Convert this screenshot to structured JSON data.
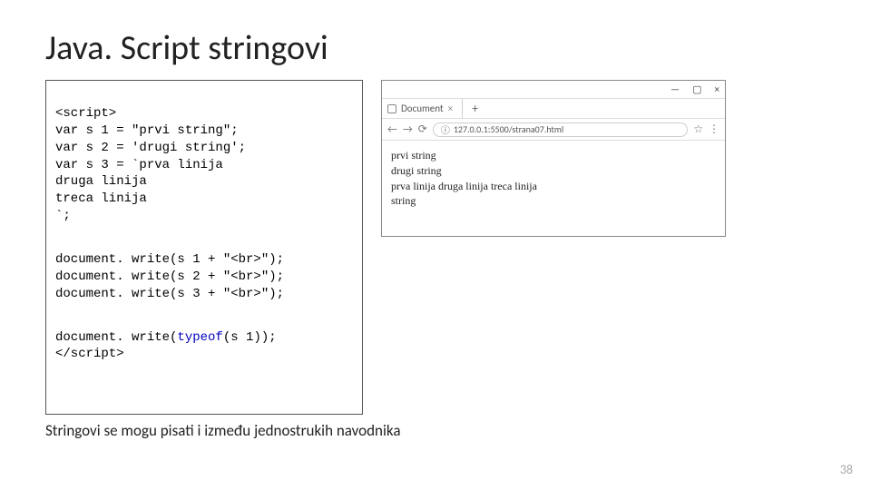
{
  "title": "Java. Script stringovi",
  "code": {
    "b1": "<script>\nvar s 1 = \"prvi string\";\nvar s 2 = 'drugi string';\nvar s 3 = `prva linija\ndruga linija\ntreca linija\n`;",
    "b2": "document. write(s 1 + \"<br>\");\ndocument. write(s 2 + \"<br>\");\ndocument. write(s 3 + \"<br>\");",
    "b3_a": "document. write(",
    "b3_kw": "typeof",
    "b3_b": "(s 1));\n</scr",
    "b3_c": "ipt>"
  },
  "browser": {
    "tab_title": "Document",
    "url_info": "ⓘ",
    "url": "127.0.0.1:5500/strana07.html",
    "plus": "+",
    "min": "—",
    "max": "▢",
    "close": "×",
    "back": "←",
    "fwd": "→",
    "reload": "⟳",
    "star": "☆",
    "menu": "⋮",
    "page_lines": [
      "prvi string",
      "drugi string",
      "prva linija druga linija treca linija",
      "string"
    ]
  },
  "footer": "Stringovi se mogu pisati i između jednostrukih navodnika",
  "page_num": "38"
}
